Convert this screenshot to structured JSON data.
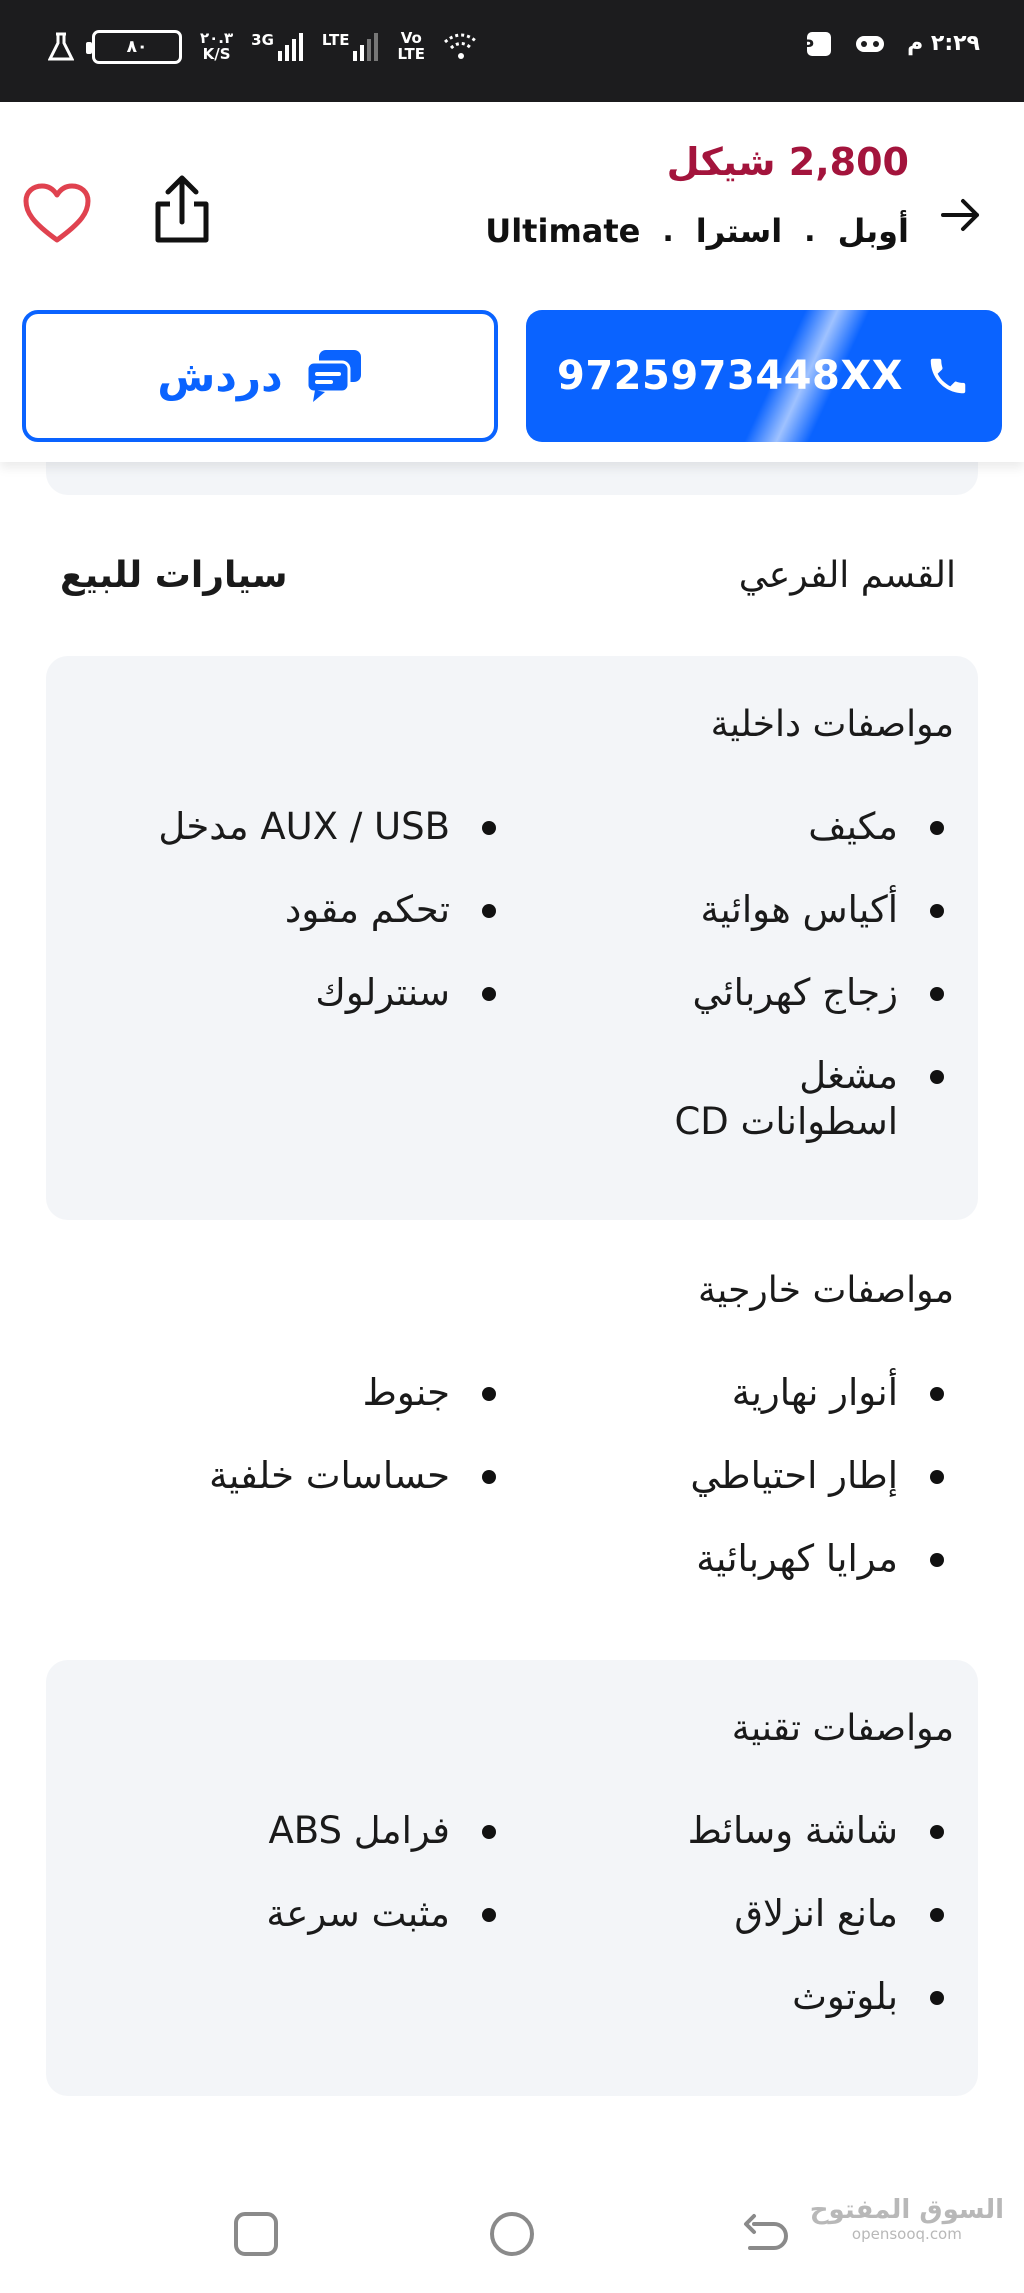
{
  "status_bar": {
    "time": "٢:٢٩ م",
    "battery": "٨٠",
    "net_speed_value": "٢٠.٣",
    "net_speed_unit": "K/S",
    "net_3g": "3G",
    "net_lte": "LTE",
    "volte_top": "Vo",
    "volte_bottom": "LTE"
  },
  "header": {
    "price": "2,800 شيكل",
    "breadcrumb": [
      "أوبل",
      "استرا",
      "Ultimate"
    ],
    "breadcrumb_sep": ".",
    "call_label": "9725973448XX",
    "chat_label": "دردش",
    "accent_color": "#0a63ff",
    "price_color": "#a3143c"
  },
  "subsection": {
    "label": "القسم الفرعي",
    "value": "سيارات للبيع"
  },
  "interior": {
    "title": "مواصفات داخلية",
    "items": [
      "مكيف",
      "AUX / USB مدخل",
      "أكياس هوائية",
      "تحكم مقود",
      "زجاج كهربائي",
      "سنترلوك",
      "مشغل اسطوانات CD"
    ]
  },
  "exterior": {
    "title": "مواصفات خارجية",
    "items": [
      "أنوار نهارية",
      "جنوط",
      "إطار احتياطي",
      "حساسات خلفية",
      "مرايا كهربائية"
    ]
  },
  "technical": {
    "title": "مواصفات تقنية",
    "items": [
      "شاشة وسائط",
      "فرامل ABS",
      "مانع انزلاق",
      "مثبت سرعة",
      "بلوتوث"
    ]
  },
  "watermark": {
    "main": "السوق المفتوح",
    "sub": "opensooq.com"
  },
  "icons": {
    "back": "arrow-right-icon",
    "share": "share-icon",
    "favorite": "heart-icon",
    "call": "phone-icon",
    "chat": "chat-icon"
  }
}
